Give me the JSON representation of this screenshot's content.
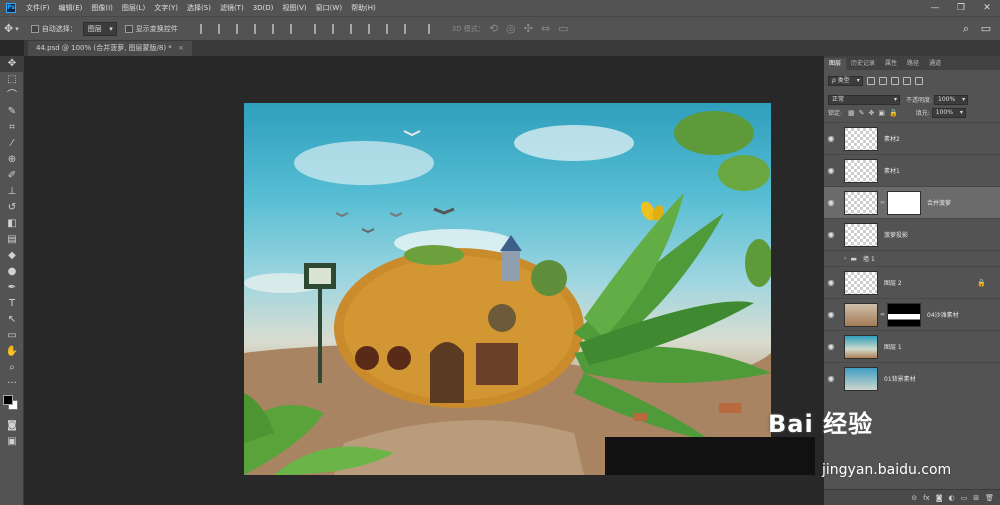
{
  "menubar": {
    "logo": "Ps",
    "items": [
      "文件(F)",
      "编辑(E)",
      "图像(I)",
      "图层(L)",
      "文字(Y)",
      "选择(S)",
      "滤镜(T)",
      "3D(D)",
      "视图(V)",
      "窗口(W)",
      "帮助(H)"
    ],
    "window_controls": [
      "—",
      "❐",
      "✕"
    ]
  },
  "options": {
    "auto_select_label": "自动选择：",
    "auto_select_value": "图层",
    "transform_label": "显示变换控件",
    "mode_3d_label": "3D 模式："
  },
  "document": {
    "tab_title": "44.psd @ 100% (合并菠萝, 图层蒙版/8) *",
    "close": "×"
  },
  "layers_panel": {
    "tabs": [
      "图层",
      "历史记录",
      "属性",
      "路径",
      "通道"
    ],
    "filter_value": "ρ 类型",
    "blend_mode": "正常",
    "opacity_label": "不透明度:",
    "opacity_value": "100%",
    "lock_label": "锁定:",
    "fill_label": "填充:",
    "fill_value": "100%",
    "layers": [
      {
        "name": "素材2",
        "visible": true,
        "thumb": "checker"
      },
      {
        "name": "素材1",
        "visible": true,
        "thumb": "checker"
      },
      {
        "name": "合并菠萝",
        "visible": true,
        "thumb": "checker",
        "mask": "white",
        "selected": true
      },
      {
        "name": "菠萝投影",
        "visible": true,
        "thumb": "checker"
      },
      {
        "name": "墙 1",
        "visible": false,
        "group": true
      },
      {
        "name": "图层 2",
        "visible": true,
        "thumb": "checker",
        "locked": true
      },
      {
        "name": "04沙滩素材",
        "visible": true,
        "thumb": "sand",
        "mask": "bw"
      },
      {
        "name": "图层 1",
        "visible": true,
        "thumb": "grad"
      },
      {
        "name": "01背景素材",
        "visible": true,
        "thumb": "sky"
      }
    ],
    "footer_buttons": [
      "⊝",
      "fx",
      "◙",
      "◐",
      "▭",
      "⊞",
      "🗑"
    ]
  },
  "watermark": {
    "logo": "Bai 经验",
    "url": "jingyan.baidu.com"
  }
}
